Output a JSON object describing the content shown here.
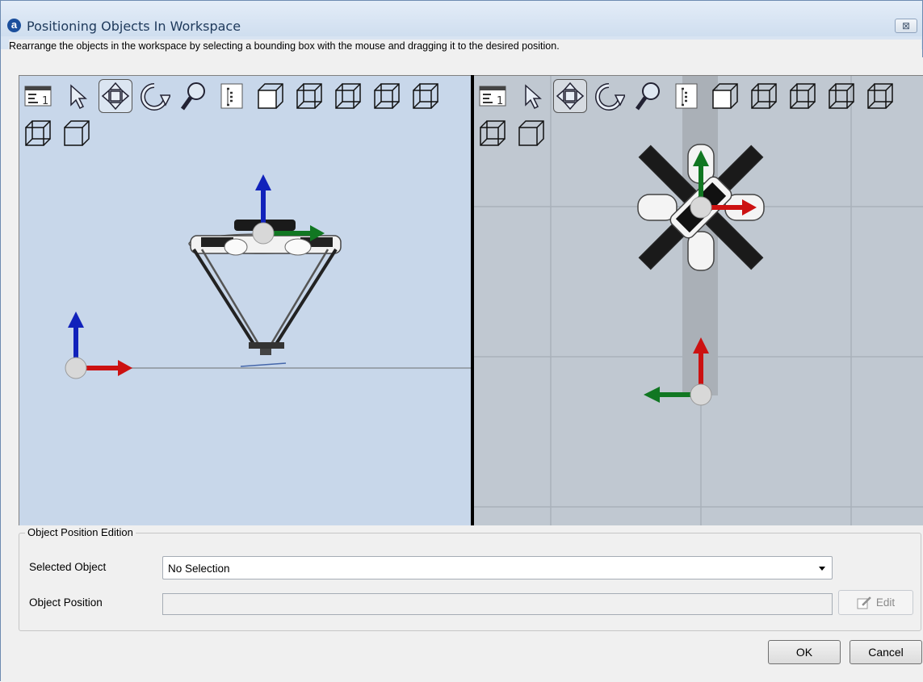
{
  "window": {
    "title": "Positioning Objects In Workspace",
    "icon_letter": "a",
    "close_glyph": "⊠",
    "instruction": "Rearrange the objects in the workspace by selecting a bounding box with the mouse and dragging it to the desired position."
  },
  "viewports": {
    "left": {
      "background": "#c8d7ea"
    },
    "right": {
      "background": "#c0c8d1"
    }
  },
  "toolbar_icons": [
    "view-layout-icon",
    "pointer-icon",
    "move-icon",
    "rotate-icon",
    "zoom-icon",
    "tree-icon",
    "cube-front-icon",
    "cube-back-icon",
    "cube-left-icon",
    "cube-right-icon",
    "cube-top-icon",
    "cube-bottom-icon",
    "cube-iso-icon"
  ],
  "toolbar_layout_label": "1",
  "position_group": {
    "legend": "Object Position Edition",
    "selected_object_label": "Selected Object",
    "selected_object_value": "No Selection",
    "object_position_label": "Object Position",
    "object_position_value": "",
    "edit_label": "Edit"
  },
  "buttons": {
    "ok": "OK",
    "cancel": "Cancel"
  },
  "colors": {
    "axis_x": "#cc1111",
    "axis_y": "#117722",
    "axis_z": "#1122bb",
    "title_text": "#1e395b"
  }
}
